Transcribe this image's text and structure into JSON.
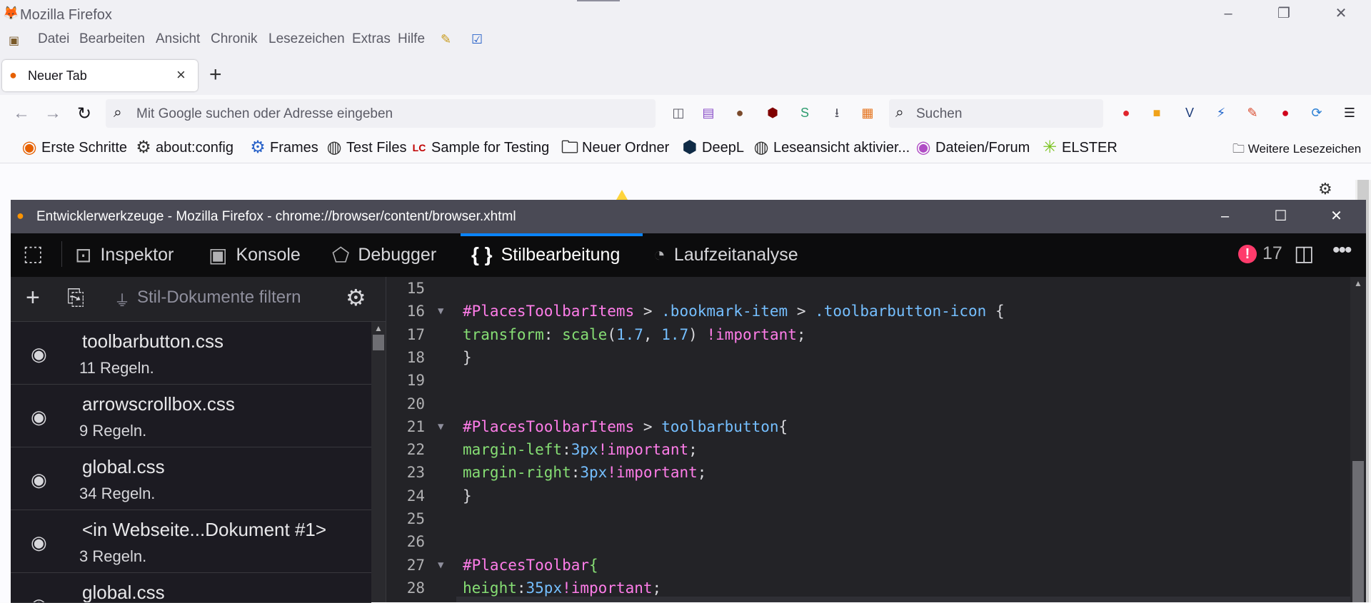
{
  "window": {
    "title": "Mozilla Firefox"
  },
  "menu": [
    "Datei",
    "Bearbeiten",
    "Ansicht",
    "Chronik",
    "Lesezeichen",
    "Extras",
    "Hilfe"
  ],
  "tab": {
    "label": "Neuer Tab"
  },
  "urlbar": {
    "placeholder": "Mit Google suchen oder Adresse eingeben"
  },
  "searchbar": {
    "placeholder": "Suchen"
  },
  "toolbar_icons": [
    {
      "name": "sidebar-icon",
      "glyph": "◫",
      "color": "#5b5b66"
    },
    {
      "name": "tabs-icon",
      "glyph": "▤",
      "color": "#8a4fc9"
    },
    {
      "name": "cookie-icon",
      "glyph": "●",
      "color": "#7a4a2b"
    },
    {
      "name": "ublock-icon",
      "glyph": "⬢",
      "color": "#800000"
    },
    {
      "name": "s-extension-icon",
      "glyph": "S",
      "color": "#2e9c6f"
    },
    {
      "name": "download-icon",
      "glyph": "⭳",
      "color": "#5b5b66"
    },
    {
      "name": "calendar-icon",
      "glyph": "▦",
      "color": "#e5731c"
    },
    {
      "name": "notify-extension-icon",
      "glyph": "●",
      "color": "#e0242c"
    },
    {
      "name": "css-extension-icon",
      "glyph": "■",
      "color": "#f0a21a"
    },
    {
      "name": "v-extension-icon",
      "glyph": "V",
      "color": "#1e3d7a"
    },
    {
      "name": "bolt-extension-icon",
      "glyph": "⚡",
      "color": "#2266cc"
    },
    {
      "name": "edit-extension-icon",
      "glyph": "✎",
      "color": "#d9482b"
    },
    {
      "name": "vivaldi-icon",
      "glyph": "●",
      "color": "#d0021b"
    },
    {
      "name": "sync-icon",
      "glyph": "⟳",
      "color": "#2a7fd4"
    },
    {
      "name": "menu-icon",
      "glyph": "☰",
      "color": "#15141a"
    }
  ],
  "bookmarks": [
    {
      "label": "Erste Schritte",
      "icon": "firefox-icon",
      "color": "#e66000"
    },
    {
      "label": "about:config",
      "icon": "gear-icon",
      "color": "#333333"
    },
    {
      "label": "Frames",
      "icon": "frames-icon",
      "color": "#2a63c9"
    },
    {
      "label": "Test Files",
      "icon": "globe-icon",
      "color": "#333333"
    },
    {
      "label": "Sample for Testing",
      "icon": "lc-icon",
      "color": "#c00000"
    },
    {
      "label": "Neuer Ordner",
      "icon": "folder-icon",
      "color": "#333333"
    },
    {
      "label": "DeepL",
      "icon": "deepl-icon",
      "color": "#0f2b46"
    },
    {
      "label": "Leseansicht aktivier...",
      "icon": "globe-icon",
      "color": "#333333"
    },
    {
      "label": "Dateien/Forum",
      "icon": "forum-icon",
      "color": "#b04cc5"
    },
    {
      "label": "ELSTER",
      "icon": "elster-icon",
      "color": "#7ac31f"
    }
  ],
  "more_bookmarks": "Weitere Lesezeichen",
  "devtools": {
    "title": "Entwicklerwerkzeuge - Mozilla Firefox - chrome://browser/content/browser.xhtml",
    "tools": [
      "Inspektor",
      "Konsole",
      "Debugger",
      "Stilbearbeitung",
      "Laufzeitanalyse"
    ],
    "active_tool": "Stilbearbeitung",
    "error_count": "17",
    "filter_placeholder": "Stil-Dokumente filtern",
    "stylesheets": [
      {
        "name": "toolbarbutton.css",
        "rules": "11 Regeln."
      },
      {
        "name": "arrowscrollbox.css",
        "rules": "9 Regeln."
      },
      {
        "name": "global.css",
        "rules": "34 Regeln."
      },
      {
        "name": "<in Webseite...Dokument #1>",
        "rules": "3 Regeln."
      },
      {
        "name": "global.css",
        "rules": ""
      }
    ],
    "code": [
      {
        "n": "15",
        "fold": false,
        "tokens": []
      },
      {
        "n": "16",
        "fold": true,
        "tokens": [
          [
            "sel",
            "#PlacesToolbarItems"
          ],
          [
            "pun",
            " > "
          ],
          [
            "cls",
            ".bookmark-item"
          ],
          [
            "pun",
            " > "
          ],
          [
            "cls",
            ".toolbarbutton-icon"
          ],
          [
            "pun",
            " {"
          ]
        ]
      },
      {
        "n": "17",
        "fold": false,
        "tokens": [
          [
            "prop",
            "transform"
          ],
          [
            "pun",
            ": "
          ],
          [
            "prop",
            "scale"
          ],
          [
            "pun",
            "("
          ],
          [
            "num-v",
            "1.7"
          ],
          [
            "pun",
            ", "
          ],
          [
            "num-v",
            "1.7"
          ],
          [
            "pun",
            ") "
          ],
          [
            "imp",
            "!important"
          ],
          [
            "pun",
            ";"
          ]
        ]
      },
      {
        "n": "18",
        "fold": false,
        "tokens": [
          [
            "pun",
            "}"
          ]
        ]
      },
      {
        "n": "19",
        "fold": false,
        "tokens": []
      },
      {
        "n": "20",
        "fold": false,
        "tokens": []
      },
      {
        "n": "21",
        "fold": true,
        "tokens": [
          [
            "sel",
            "#PlacesToolbarItems"
          ],
          [
            "pun",
            " > "
          ],
          [
            "cls",
            "toolbarbutton"
          ],
          [
            "pun",
            "{"
          ]
        ]
      },
      {
        "n": "22",
        "fold": false,
        "tokens": [
          [
            "prop",
            "margin-left"
          ],
          [
            "pun",
            ":"
          ],
          [
            "num-v",
            "3px"
          ],
          [
            "imp",
            "!important"
          ],
          [
            "pun",
            ";"
          ]
        ]
      },
      {
        "n": "23",
        "fold": false,
        "tokens": [
          [
            "prop",
            "margin-right"
          ],
          [
            "pun",
            ":"
          ],
          [
            "num-v",
            "3px"
          ],
          [
            "imp",
            "!important"
          ],
          [
            "pun",
            ";"
          ]
        ]
      },
      {
        "n": "24",
        "fold": false,
        "tokens": [
          [
            "pun",
            "}"
          ]
        ]
      },
      {
        "n": "25",
        "fold": false,
        "tokens": []
      },
      {
        "n": "26",
        "fold": false,
        "tokens": []
      },
      {
        "n": "27",
        "fold": true,
        "tokens": [
          [
            "sel",
            "#PlacesToolbar"
          ],
          [
            "prop",
            "{"
          ]
        ]
      },
      {
        "n": "28",
        "fold": false,
        "tokens": [
          [
            "prop",
            "height"
          ],
          [
            "pun",
            ":"
          ],
          [
            "num-v",
            "35px"
          ],
          [
            "imp",
            "!important"
          ],
          [
            "pun",
            ";"
          ]
        ]
      }
    ]
  }
}
